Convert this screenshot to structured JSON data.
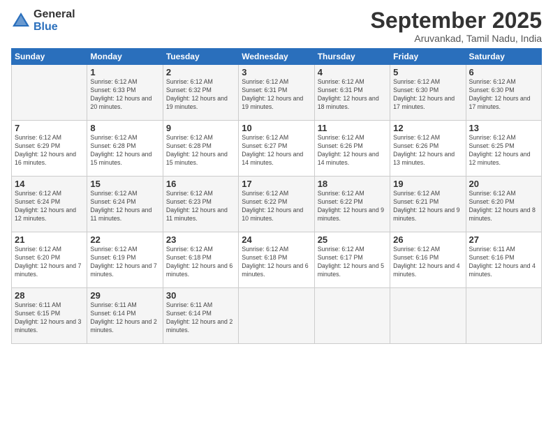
{
  "logo": {
    "general": "General",
    "blue": "Blue"
  },
  "title": "September 2025",
  "subtitle": "Aruvankad, Tamil Nadu, India",
  "days_header": [
    "Sunday",
    "Monday",
    "Tuesday",
    "Wednesday",
    "Thursday",
    "Friday",
    "Saturday"
  ],
  "weeks": [
    [
      {
        "num": "",
        "sunrise": "",
        "sunset": "",
        "daylight": ""
      },
      {
        "num": "1",
        "sunrise": "Sunrise: 6:12 AM",
        "sunset": "Sunset: 6:33 PM",
        "daylight": "Daylight: 12 hours and 20 minutes."
      },
      {
        "num": "2",
        "sunrise": "Sunrise: 6:12 AM",
        "sunset": "Sunset: 6:32 PM",
        "daylight": "Daylight: 12 hours and 19 minutes."
      },
      {
        "num": "3",
        "sunrise": "Sunrise: 6:12 AM",
        "sunset": "Sunset: 6:31 PM",
        "daylight": "Daylight: 12 hours and 19 minutes."
      },
      {
        "num": "4",
        "sunrise": "Sunrise: 6:12 AM",
        "sunset": "Sunset: 6:31 PM",
        "daylight": "Daylight: 12 hours and 18 minutes."
      },
      {
        "num": "5",
        "sunrise": "Sunrise: 6:12 AM",
        "sunset": "Sunset: 6:30 PM",
        "daylight": "Daylight: 12 hours and 17 minutes."
      },
      {
        "num": "6",
        "sunrise": "Sunrise: 6:12 AM",
        "sunset": "Sunset: 6:30 PM",
        "daylight": "Daylight: 12 hours and 17 minutes."
      }
    ],
    [
      {
        "num": "7",
        "sunrise": "Sunrise: 6:12 AM",
        "sunset": "Sunset: 6:29 PM",
        "daylight": "Daylight: 12 hours and 16 minutes."
      },
      {
        "num": "8",
        "sunrise": "Sunrise: 6:12 AM",
        "sunset": "Sunset: 6:28 PM",
        "daylight": "Daylight: 12 hours and 15 minutes."
      },
      {
        "num": "9",
        "sunrise": "Sunrise: 6:12 AM",
        "sunset": "Sunset: 6:28 PM",
        "daylight": "Daylight: 12 hours and 15 minutes."
      },
      {
        "num": "10",
        "sunrise": "Sunrise: 6:12 AM",
        "sunset": "Sunset: 6:27 PM",
        "daylight": "Daylight: 12 hours and 14 minutes."
      },
      {
        "num": "11",
        "sunrise": "Sunrise: 6:12 AM",
        "sunset": "Sunset: 6:26 PM",
        "daylight": "Daylight: 12 hours and 14 minutes."
      },
      {
        "num": "12",
        "sunrise": "Sunrise: 6:12 AM",
        "sunset": "Sunset: 6:26 PM",
        "daylight": "Daylight: 12 hours and 13 minutes."
      },
      {
        "num": "13",
        "sunrise": "Sunrise: 6:12 AM",
        "sunset": "Sunset: 6:25 PM",
        "daylight": "Daylight: 12 hours and 12 minutes."
      }
    ],
    [
      {
        "num": "14",
        "sunrise": "Sunrise: 6:12 AM",
        "sunset": "Sunset: 6:24 PM",
        "daylight": "Daylight: 12 hours and 12 minutes."
      },
      {
        "num": "15",
        "sunrise": "Sunrise: 6:12 AM",
        "sunset": "Sunset: 6:24 PM",
        "daylight": "Daylight: 12 hours and 11 minutes."
      },
      {
        "num": "16",
        "sunrise": "Sunrise: 6:12 AM",
        "sunset": "Sunset: 6:23 PM",
        "daylight": "Daylight: 12 hours and 11 minutes."
      },
      {
        "num": "17",
        "sunrise": "Sunrise: 6:12 AM",
        "sunset": "Sunset: 6:22 PM",
        "daylight": "Daylight: 12 hours and 10 minutes."
      },
      {
        "num": "18",
        "sunrise": "Sunrise: 6:12 AM",
        "sunset": "Sunset: 6:22 PM",
        "daylight": "Daylight: 12 hours and 9 minutes."
      },
      {
        "num": "19",
        "sunrise": "Sunrise: 6:12 AM",
        "sunset": "Sunset: 6:21 PM",
        "daylight": "Daylight: 12 hours and 9 minutes."
      },
      {
        "num": "20",
        "sunrise": "Sunrise: 6:12 AM",
        "sunset": "Sunset: 6:20 PM",
        "daylight": "Daylight: 12 hours and 8 minutes."
      }
    ],
    [
      {
        "num": "21",
        "sunrise": "Sunrise: 6:12 AM",
        "sunset": "Sunset: 6:20 PM",
        "daylight": "Daylight: 12 hours and 7 minutes."
      },
      {
        "num": "22",
        "sunrise": "Sunrise: 6:12 AM",
        "sunset": "Sunset: 6:19 PM",
        "daylight": "Daylight: 12 hours and 7 minutes."
      },
      {
        "num": "23",
        "sunrise": "Sunrise: 6:12 AM",
        "sunset": "Sunset: 6:18 PM",
        "daylight": "Daylight: 12 hours and 6 minutes."
      },
      {
        "num": "24",
        "sunrise": "Sunrise: 6:12 AM",
        "sunset": "Sunset: 6:18 PM",
        "daylight": "Daylight: 12 hours and 6 minutes."
      },
      {
        "num": "25",
        "sunrise": "Sunrise: 6:12 AM",
        "sunset": "Sunset: 6:17 PM",
        "daylight": "Daylight: 12 hours and 5 minutes."
      },
      {
        "num": "26",
        "sunrise": "Sunrise: 6:12 AM",
        "sunset": "Sunset: 6:16 PM",
        "daylight": "Daylight: 12 hours and 4 minutes."
      },
      {
        "num": "27",
        "sunrise": "Sunrise: 6:11 AM",
        "sunset": "Sunset: 6:16 PM",
        "daylight": "Daylight: 12 hours and 4 minutes."
      }
    ],
    [
      {
        "num": "28",
        "sunrise": "Sunrise: 6:11 AM",
        "sunset": "Sunset: 6:15 PM",
        "daylight": "Daylight: 12 hours and 3 minutes."
      },
      {
        "num": "29",
        "sunrise": "Sunrise: 6:11 AM",
        "sunset": "Sunset: 6:14 PM",
        "daylight": "Daylight: 12 hours and 2 minutes."
      },
      {
        "num": "30",
        "sunrise": "Sunrise: 6:11 AM",
        "sunset": "Sunset: 6:14 PM",
        "daylight": "Daylight: 12 hours and 2 minutes."
      },
      {
        "num": "",
        "sunrise": "",
        "sunset": "",
        "daylight": ""
      },
      {
        "num": "",
        "sunrise": "",
        "sunset": "",
        "daylight": ""
      },
      {
        "num": "",
        "sunrise": "",
        "sunset": "",
        "daylight": ""
      },
      {
        "num": "",
        "sunrise": "",
        "sunset": "",
        "daylight": ""
      }
    ]
  ]
}
